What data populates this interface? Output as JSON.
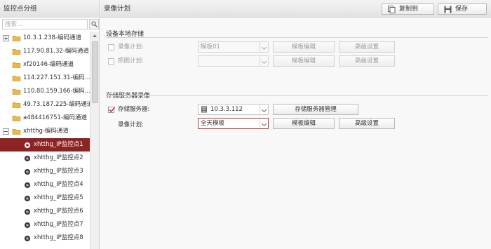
{
  "left_panel": {
    "title": "监控点分组",
    "search_placeholder": "搜索...",
    "tree": [
      {
        "label": "10.3.1.238-编码通道",
        "kind": "group",
        "expander": "plus"
      },
      {
        "label": "117.90.81.32-编码通道",
        "kind": "group"
      },
      {
        "label": "xf20146-编码通道",
        "kind": "group"
      },
      {
        "label": "114.227.151.31-编码…",
        "kind": "group"
      },
      {
        "label": "110.80.159.166-编码…",
        "kind": "group"
      },
      {
        "label": "49.73.187.225-编码通道",
        "kind": "group"
      },
      {
        "label": "a484416751-编码通道",
        "kind": "group"
      },
      {
        "label": "xhtthg-编码通道",
        "kind": "group",
        "expander": "minus"
      },
      {
        "label": "xhtthg_IP监控点1",
        "kind": "camera",
        "selected": true
      },
      {
        "label": "xhtthg_IP监控点2",
        "kind": "camera"
      },
      {
        "label": "xhtthg_IP监控点3",
        "kind": "camera"
      },
      {
        "label": "xhtthg_IP监控点4",
        "kind": "camera"
      },
      {
        "label": "xhtthg_IP监控点5",
        "kind": "camera"
      },
      {
        "label": "xhtthg_IP监控点6",
        "kind": "camera"
      },
      {
        "label": "xhtthg_IP监控点7",
        "kind": "camera"
      },
      {
        "label": "xhtthg_IP监控点8",
        "kind": "camera"
      }
    ]
  },
  "header": {
    "title": "录像计划",
    "copy_label": "复制到",
    "save_label": "保存"
  },
  "local_storage": {
    "title": "设备本地存储",
    "record_plan_label": "录像计划:",
    "record_plan_value": "模板01",
    "capture_plan_label": "抓图计划:",
    "capture_plan_value": "",
    "template_edit_label": "模板编辑",
    "advanced_label": "高级设置"
  },
  "server_storage": {
    "title": "存储服务器录像",
    "server_label": "存储服务器:",
    "server_value": "10.3.3.112",
    "server_manage_label": "存储服务器管理",
    "record_plan_label": "录像计划:",
    "record_plan_value": "全天模板",
    "template_edit_label": "模板编辑",
    "advanced_label": "高级设置"
  },
  "colors": {
    "selected_row": "#8e2323",
    "folder": "#e9b949",
    "check_mark": "#c0393b"
  }
}
